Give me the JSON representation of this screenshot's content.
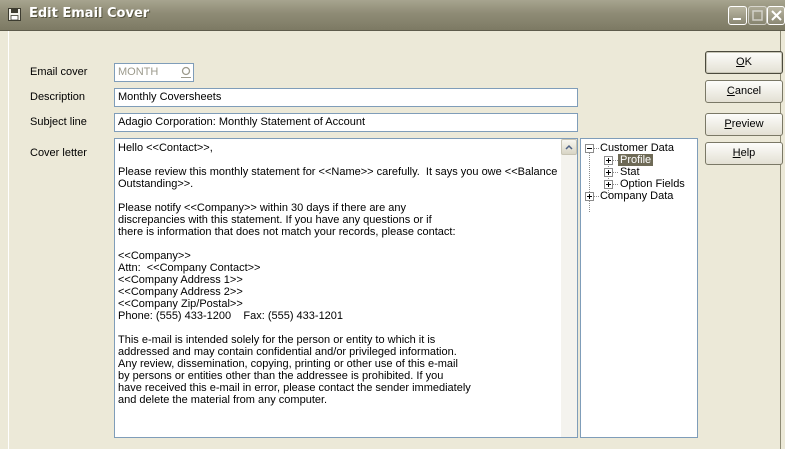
{
  "window": {
    "title": "Edit Email Cover"
  },
  "form": {
    "email_cover_label": "Email cover",
    "email_cover_value": "MONTH",
    "description_label": "Description",
    "description_value": "Monthly Coversheets",
    "subject_label": "Subject line",
    "subject_value": "Adagio Corporation: Monthly Statement of Account",
    "cover_letter_label": "Cover letter",
    "cover_letter_text": "Hello <<Contact>>,\n\nPlease review this monthly statement for <<Name>> carefully.  It says you owe <<Balance\nOutstanding>>.\n\nPlease notify <<Company>> within 30 days if there are any\ndiscrepancies with this statement. If you have any questions or if\nthere is information that does not match your records, please contact:\n\n<<Company>>\nAttn:  <<Company Contact>>\n<<Company Address 1>>\n<<Company Address 2>>\n<<Company Zip/Postal>>\nPhone: (555) 433-1200    Fax: (555) 433-1201\n\nThis e-mail is intended solely for the person or entity to which it is\naddressed and may contain confidential and/or privileged information.\nAny review, dissemination, copying, printing or other use of this e-mail\nby persons or entities other than the addressee is prohibited. If you\nhave received this e-mail in error, please contact the sender immediately\nand delete the material from any computer."
  },
  "tree": {
    "customer_data": "Customer Data",
    "profile": "Profile",
    "stat": "Stat",
    "option_fields": "Option Fields",
    "company_data": "Company Data"
  },
  "buttons": {
    "ok": {
      "mnemonic": "O",
      "rest": "K"
    },
    "cancel": {
      "mnemonic": "C",
      "rest": "ancel"
    },
    "preview": {
      "mnemonic": "P",
      "rest": "review"
    },
    "help": {
      "mnemonic": "H",
      "rest": "elp"
    }
  },
  "icons": {
    "title_icon": "floppy-disk-icon",
    "finder": "magnifier-icon",
    "minimize": "minimize-icon",
    "maximize": "maximize-icon",
    "close": "close-icon"
  }
}
